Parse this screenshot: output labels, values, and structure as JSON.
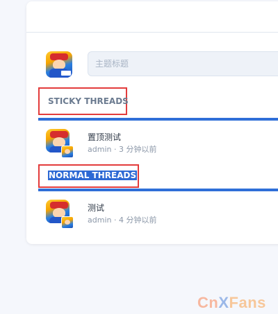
{
  "compose": {
    "placeholder": "主题标题"
  },
  "sections": {
    "sticky": "STICKY THREADS",
    "normal": "NORMAL THREADS"
  },
  "threads": [
    {
      "title": "置顶测试",
      "author": "admin",
      "time": "3 分钟以前"
    },
    {
      "title": "测试",
      "author": "admin",
      "time": "4 分钟以前"
    }
  ],
  "watermark": {
    "part1": "Cn",
    "part2": "X",
    "part3": "Fans"
  },
  "colors": {
    "accent": "#2f6fd8",
    "highlight_box": "#e33b3b",
    "background": "#f5f7fc"
  }
}
